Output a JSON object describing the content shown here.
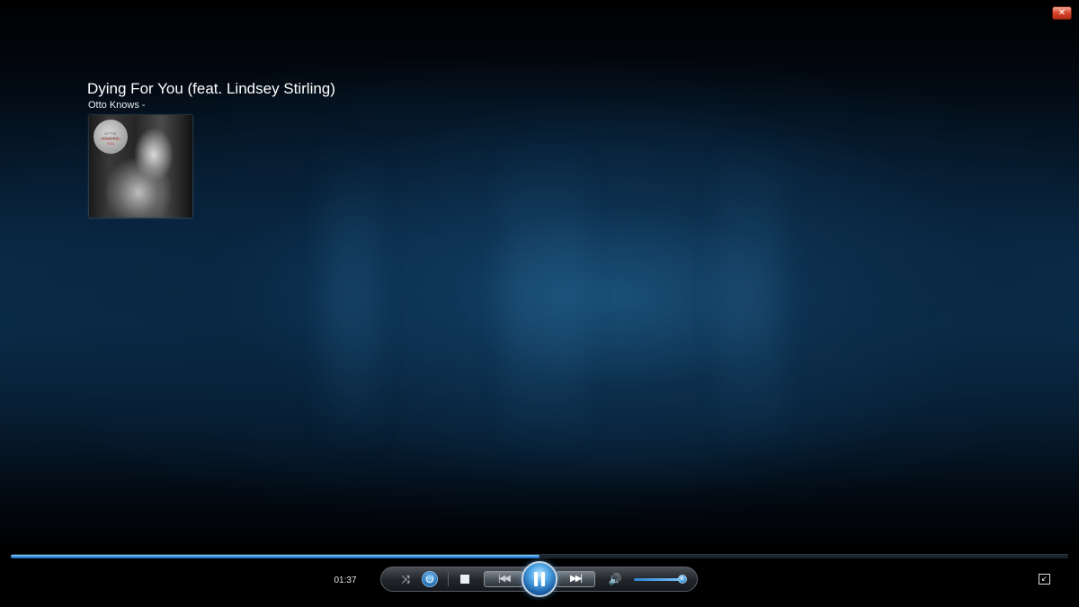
{
  "window": {
    "close_glyph": "✕"
  },
  "now_playing": {
    "title": "Dying For You (feat. Lindsey Stirling)",
    "artist_line": "Otto Knows -",
    "album_art": {
      "cover_text_artist": "OTTO KNOWS",
      "cover_text_title": "DYING FOR YOU"
    }
  },
  "playback": {
    "elapsed": "01:37",
    "progress_fraction": 0.5,
    "state": "playing"
  },
  "controls": {
    "shuffle_glyph": "⤨",
    "stop_label": "",
    "prev_glyph": "|◀◀",
    "next_glyph": "▶▶|",
    "volume_glyph": "🔊",
    "volume_fraction": 0.9
  },
  "colors": {
    "accent": "#2e86d3",
    "close_red": "#d7452a"
  }
}
